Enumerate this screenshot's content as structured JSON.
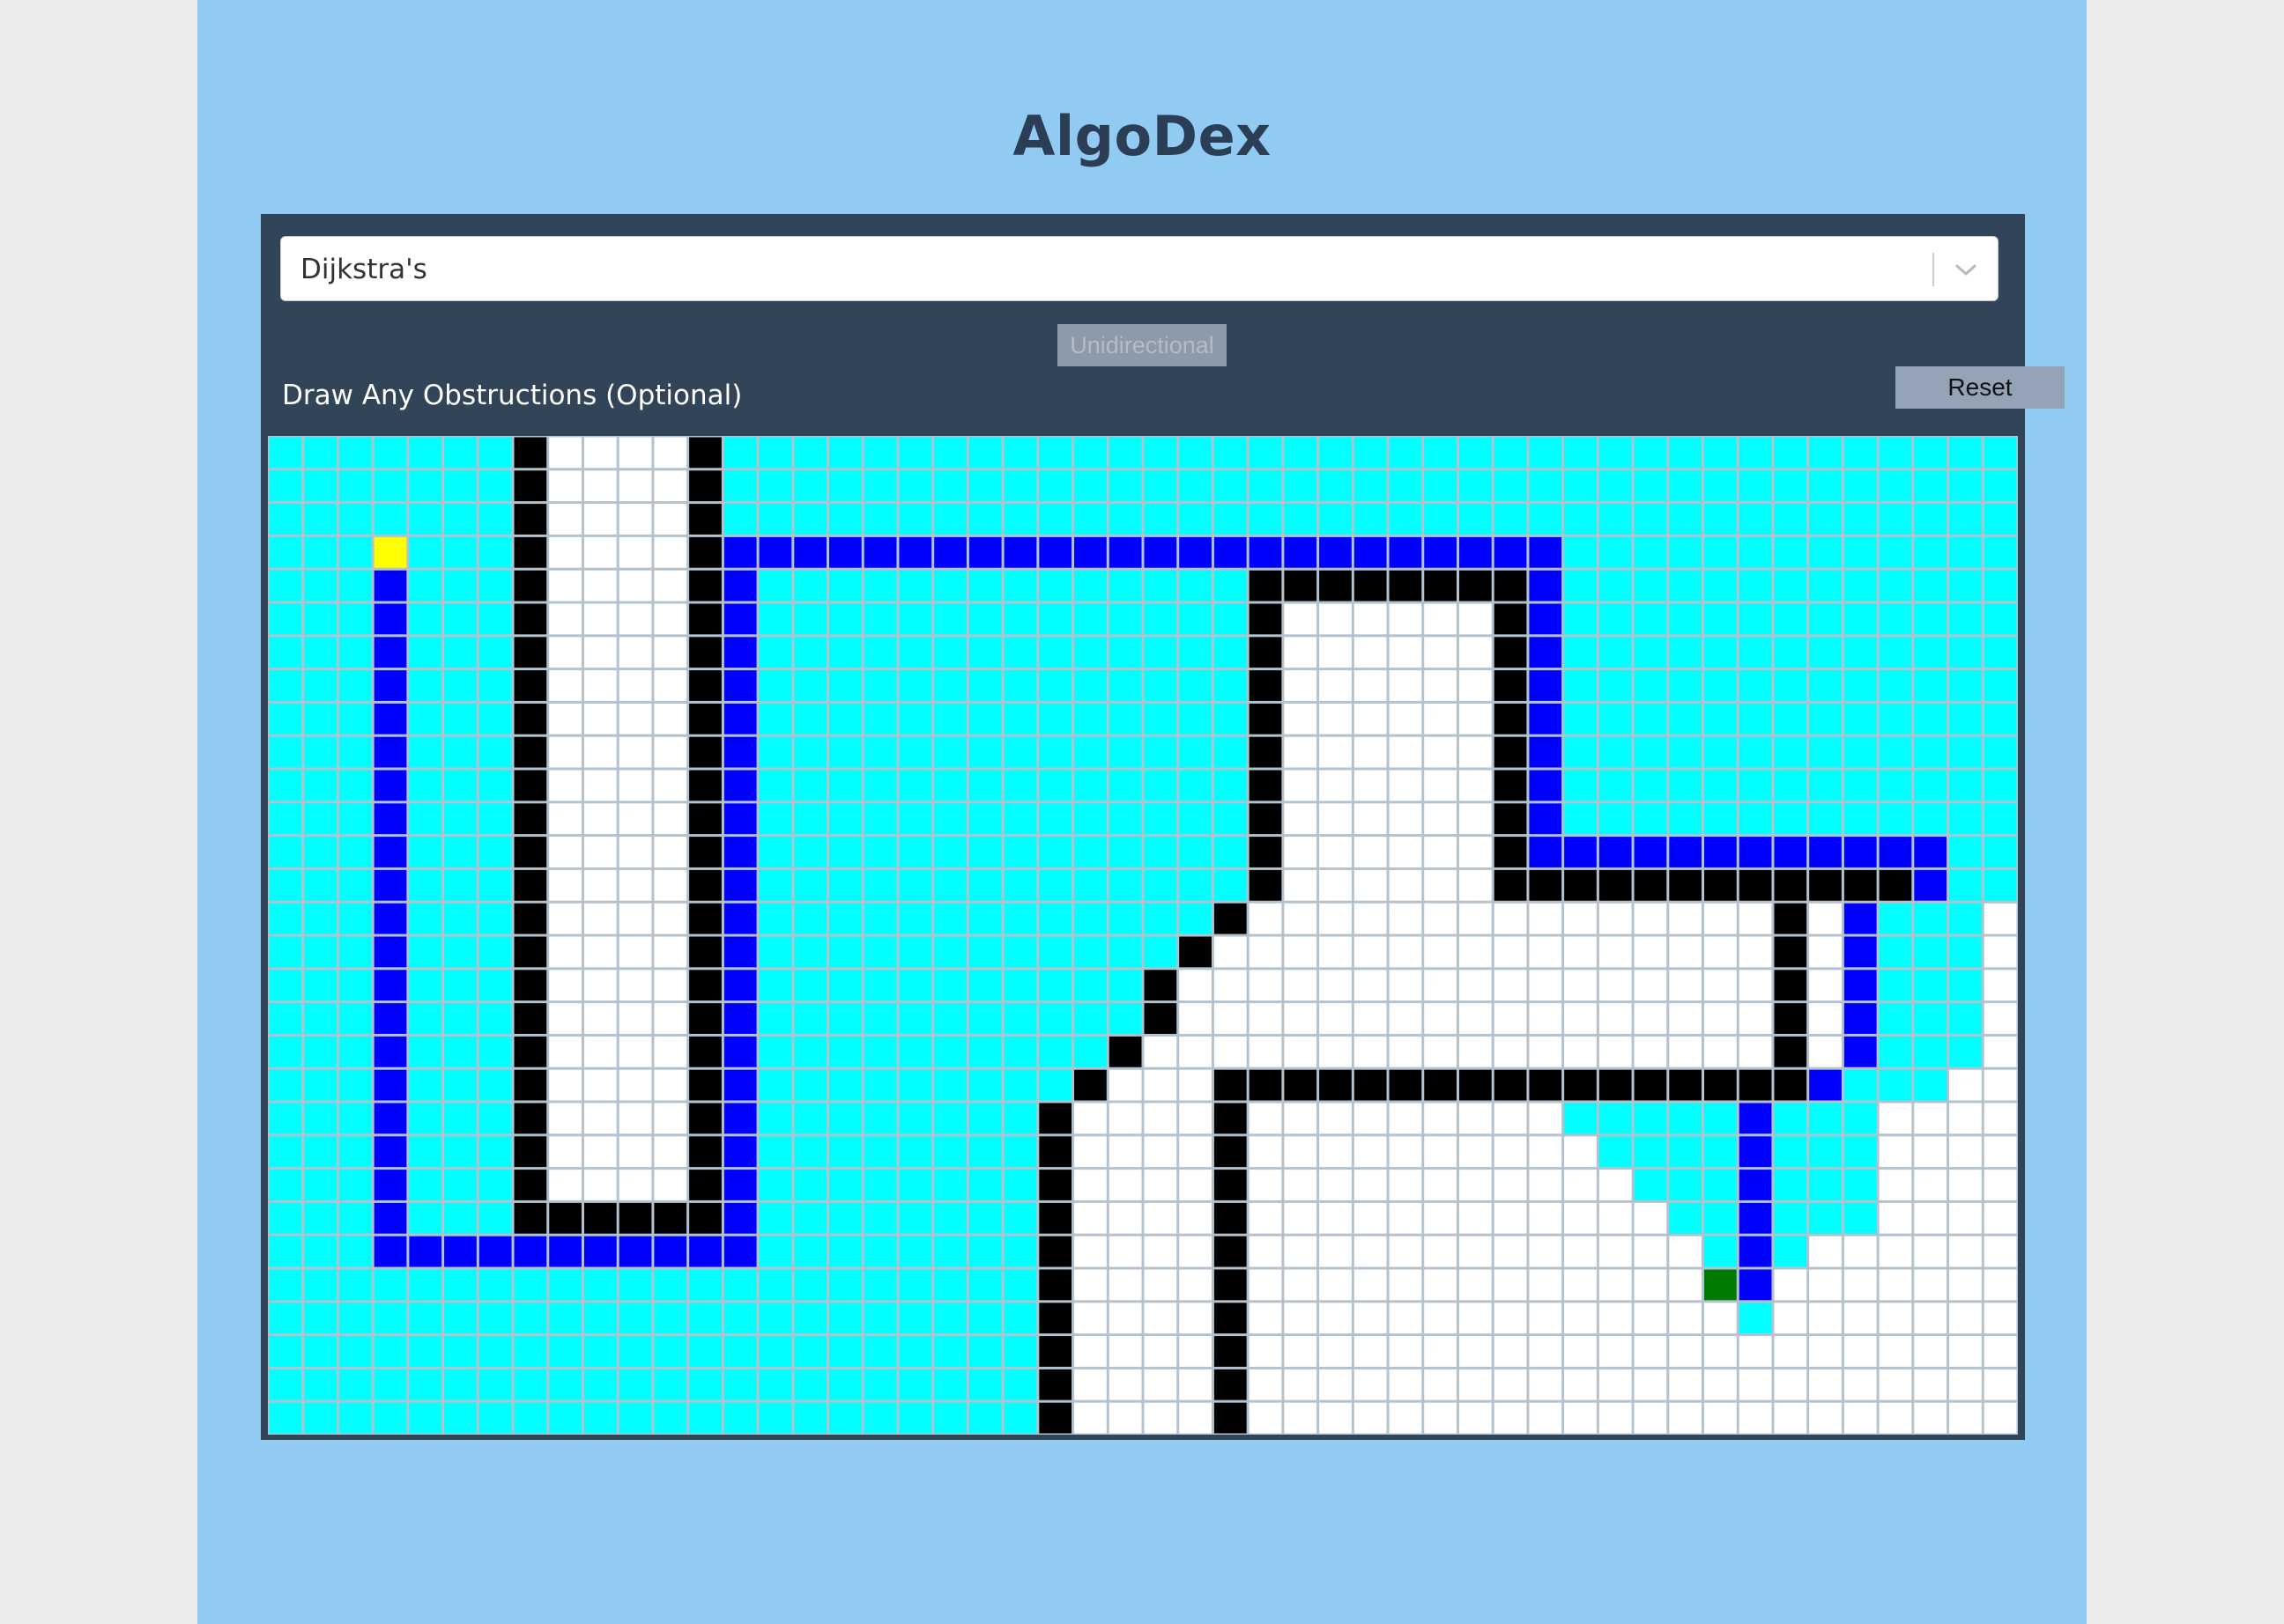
{
  "app": {
    "title": "AlgoDex"
  },
  "algorithm_select": {
    "value": "Dijkstra's",
    "icon": "chevron-down-icon"
  },
  "mode_button": {
    "label": "Unidirectional"
  },
  "instructions": {
    "text": "Draw Any Obstructions (Optional)"
  },
  "reset_button": {
    "label": "Reset"
  },
  "grid": {
    "rows": 30,
    "cols": 50,
    "cell_legend": {
      "W": "wall",
      "V": "visited",
      "P": "path",
      "S": "start",
      "T": "target",
      ".": "empty"
    },
    "colors": {
      "wall": "#000000",
      "visited": "#00ffff",
      "path": "#0000ff",
      "start": "#ffff00",
      "target": "#007a00",
      "empty": "#ffffff",
      "gridline": "#b3c2cf"
    },
    "cells": [
      "VVVVVVVW....WVVVVVVVVVVVVVVVVVVVVVVVVVVVVVVVVVVVVV",
      "VVVVVVVW....WVVVVVVVVVVVVVVVVVVVVVVVVVVVVVVVVVVVVV",
      "VVVVVVVW....WVVVVVVVVVVVVVVVVVVVVVVVVVVVVVVVVVVVVV",
      "VVVSVVVW....WPPPPPPPPPPPPPPPPPPPPPPPPVVVVVVVVVVVVVV",
      "VVVPVVVW....WPVVVVVVVVVVVVVVWWWWWWWWPVVVVVVVVVVVVV",
      "VVVPVVVW....WPVVVVVVVVVVVVVVW......WPVVVVVVVVVVVVV",
      "VVVPVVVW....WPVVVVVVVVVVVVVVW......WPVVVVVVVVVVVVV",
      "VVVPVVVW....WPVVVVVVVVVVVVVVW......WPVVVVVVVVVVVVV",
      "VVVPVVVW....WPVVVVVVVVVVVVVVW......WPVVVVVVVVVVVVV",
      "VVVPVVVW....WPVVVVVVVVVVVVVVW......WPVVVVVVVVVVVVV",
      "VVVPVVVW....WPVVVVVVVVVVVVVVW......WPVVVVVVVVVVVVV",
      "VVVPVVVW....WPVVVVVVVVVVVVVVW......WPVVVVVVVVVVVVV",
      "VVVPVVVW....WPVVVVVVVVVVVVVVW......WPPPPPPPPPPPPVVV",
      "VVVPVVVW....WPVVVVVVVVVVVVVVW......WWWWWWWWWWWWPVVV",
      "VVVPVVVW....WPVVVVVVVVVVVVVW...............W.PVVV",
      "VVVPVVVW....WPVVVVVVVVVVVVW................W.PVVV",
      "VVVPVVVW....WPVVVVVVVVVVVW.................W.PVVV",
      "VVVPVVVW....WPVVVVVVVVVVVW.................W.PVVV",
      "VVVPVVVW....WPVVVVVVVVVVW..................W.PVVV",
      "VVVPVVVW....WPVVVVVVVVVW...WWWWWWWWWWWWWWWWWPVVV",
      "VVVPVVVW....WPVVVVVVVVW....W.........VVVVVPVVV",
      "VVVPVVVW....WPVVVVVVVVW....W..........VVVVPVVV",
      "VVVPVVVW....WPVVVVVVVVW....W...........VVVPVVV",
      "VVVPVVVWWWWWWPVVVVVVVVW....W............VVPVVV",
      "VVVPPPPPPPPPPPVVVVVVVVW....W.............VPV..",
      "VVVVVVVVVVVVVVVVVVVVVVW....W.............TP...",
      "VVVVVVVVVVVVVVVVVVVVVVW....W..............V...",
      "VVVVVVVVVVVVVVVVVVVVVVW....W..................",
      "VVVVVVVVVVVVVVVVVVVVVVW....W..................",
      "VVVVVVVVVVVVVVVVVVVVVVW....W.................."
    ]
  }
}
